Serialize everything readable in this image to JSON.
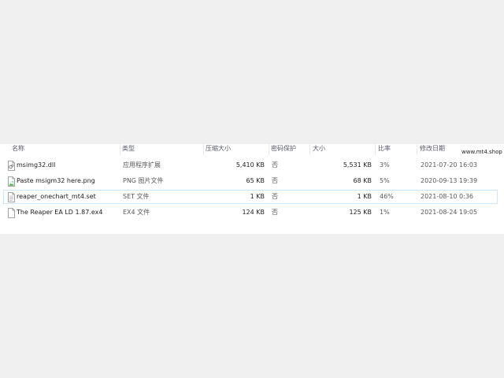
{
  "columns": {
    "name": "名称",
    "type": "类型",
    "compressed_size": "压缩大小",
    "password": "密码保护",
    "size": "大小",
    "ratio": "比率",
    "modified": "修改日期"
  },
  "watermark": "www.mt4.shop",
  "files": [
    {
      "icon": "dll-file-icon",
      "name": "msimg32.dll",
      "type": "应用程序扩展",
      "compressed_size": "5,410 KB",
      "password": "否",
      "size": "5,531 KB",
      "ratio": "3%",
      "modified": "2021-07-20 16:03"
    },
    {
      "icon": "image-file-icon",
      "name": "Paste msigm32 here.png",
      "type": "PNG 图片文件",
      "compressed_size": "65 KB",
      "password": "否",
      "size": "68 KB",
      "ratio": "5%",
      "modified": "2020-09-13 19:39"
    },
    {
      "icon": "text-file-icon",
      "name": "reaper_onechart_mt4.set",
      "type": "SET 文件",
      "compressed_size": "1 KB",
      "password": "否",
      "size": "1 KB",
      "ratio": "46%",
      "modified": "2021-08-10 0:36"
    },
    {
      "icon": "blank-file-icon",
      "name": "The Reaper EA LD 1.87.ex4",
      "type": "EX4 文件",
      "compressed_size": "124 KB",
      "password": "否",
      "size": "125 KB",
      "ratio": "1%",
      "modified": "2021-08-24 19:05"
    }
  ],
  "selected_row": 2
}
